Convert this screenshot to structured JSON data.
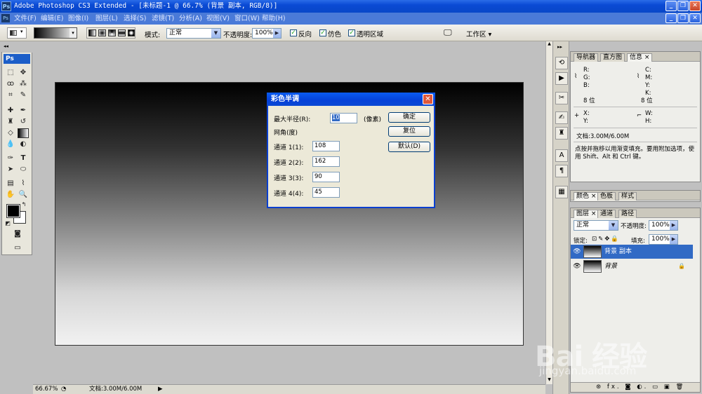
{
  "window": {
    "title": "Adobe Photoshop CS3 Extended - [未标题-1 @ 66.7% (背景 副本, RGB/8)]",
    "ps_logo": "Ps"
  },
  "menu": [
    "文件(F)",
    "编辑(E)",
    "图像(I)",
    "图层(L)",
    "选择(S)",
    "滤镜(T)",
    "分析(A)",
    "视图(V)",
    "窗口(W)",
    "帮助(H)"
  ],
  "options": {
    "mode_label": "模式:",
    "mode_value": "正常",
    "opacity_label": "不透明度:",
    "opacity_value": "100%",
    "reverse": "反向",
    "dither": "仿色",
    "transparency": "透明区域",
    "workspace": "工作区 ▾"
  },
  "toolbox": {
    "logo": "Ps"
  },
  "dialog": {
    "title": "彩色半调",
    "max_radius_label": "最大半径(R):",
    "max_radius_value": "10",
    "unit": "(像素)",
    "screen_angles": "网角(度)",
    "channels": [
      {
        "label": "通道 1(1):",
        "value": "108"
      },
      {
        "label": "通道 2(2):",
        "value": "162"
      },
      {
        "label": "通道 3(3):",
        "value": "90"
      },
      {
        "label": "通道 4(4):",
        "value": "45"
      }
    ],
    "ok": "确定",
    "reset": "复位",
    "default": "默认(D)"
  },
  "nav_panel": {
    "tabs": [
      "导航器",
      "直方图",
      "信息 ×"
    ],
    "r": "R:",
    "g": "G:",
    "b": "B:",
    "bit1": "8 位",
    "c": "C:",
    "m": "M:",
    "y": "Y:",
    "k": "K:",
    "bit2": "8 位",
    "x": "X:",
    "yy": "Y:",
    "w": "W:",
    "h": "H:",
    "doc": "文档:3.00M/6.00M",
    "hint": "点按并拖移以用渐变填充。要用附加选项，使用 Shift、Alt 和 Ctrl 键。"
  },
  "color_panel": {
    "tabs": [
      "颜色 ×",
      "色板",
      "样式"
    ]
  },
  "layers_panel": {
    "tabs": [
      "图层 ×",
      "通道",
      "路径"
    ],
    "blend": "正常",
    "opacity_label": "不透明度:",
    "opacity_value": "100%",
    "lock_label": "锁定:",
    "fill_label": "填充:",
    "fill_value": "100%",
    "layers": [
      {
        "name": "背景 副本",
        "selected": true
      },
      {
        "name": "背景",
        "selected": false
      }
    ],
    "footer": "⊛ fx. ◙ ◐. ▭ ▣ 🗑"
  },
  "status": {
    "zoom": "66.67%",
    "doc": "文档:3.00M/6.00M"
  },
  "watermark": {
    "line1": "Bai 经验",
    "line2": "jingyan.baidu.com"
  }
}
